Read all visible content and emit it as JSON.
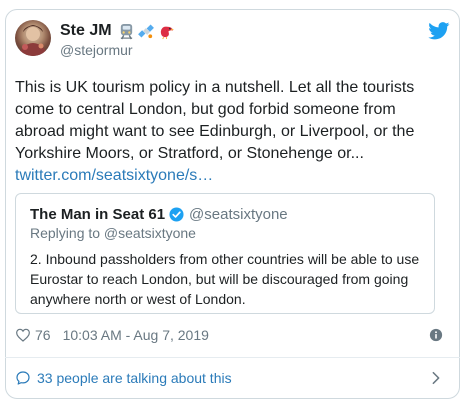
{
  "author": {
    "display_name": "Ste JM",
    "handle": "@stejormur",
    "emojis": [
      "train-icon",
      "satellite-icon",
      "bird-icon"
    ]
  },
  "tweet": {
    "text": "This is UK tourism policy in a nutshell. Let all the tourists come to central London, but god forbid someone from abroad might want to see Edinburgh, or Liverpool, or the Yorkshire Moors, or Stratford, or Stonehenge or...",
    "link": "twitter.com/seatsixtyone/s…"
  },
  "quoted_tweet": {
    "display_name": "The Man in Seat 61",
    "handle": "@seatsixtyone",
    "replying_to": "Replying to @seatsixtyone",
    "text": "2.  Inbound passholders from other countries will be able to use Eurostar to reach London, but will be discouraged from going anywhere north or west of London."
  },
  "meta": {
    "likes": "76",
    "timestamp": "10:03 AM - Aug 7, 2019"
  },
  "footer": {
    "talking": "33 people are talking about this"
  },
  "colors": {
    "link": "#2b7bb9",
    "secondary_text": "#697882",
    "border": "#cfd9de",
    "twitter_blue": "#1da1f2"
  }
}
